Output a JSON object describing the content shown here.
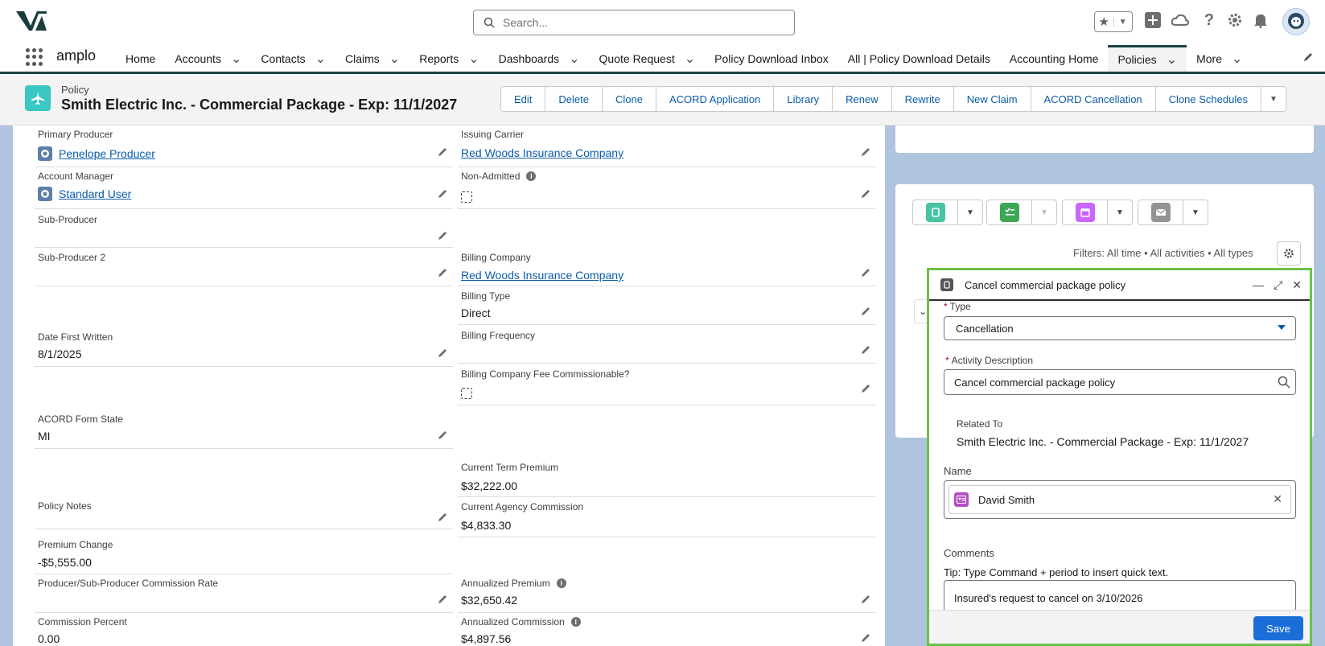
{
  "app": {
    "name": "amplo",
    "search_placeholder": "Search..."
  },
  "nav": {
    "items": [
      {
        "label": "Home",
        "dropdown": false
      },
      {
        "label": "Accounts",
        "dropdown": true
      },
      {
        "label": "Contacts",
        "dropdown": true
      },
      {
        "label": "Claims",
        "dropdown": true
      },
      {
        "label": "Reports",
        "dropdown": true
      },
      {
        "label": "Dashboards",
        "dropdown": true
      },
      {
        "label": "Quote Request",
        "dropdown": true
      },
      {
        "label": "Policy Download Inbox",
        "dropdown": false
      },
      {
        "label": "All | Policy Download Details",
        "dropdown": false
      },
      {
        "label": "Accounting Home",
        "dropdown": false
      },
      {
        "label": "Policies",
        "dropdown": true,
        "active": true
      },
      {
        "label": "More",
        "dropdown": true
      }
    ]
  },
  "record": {
    "object_type": "Policy",
    "title": "Smith Electric Inc. - Commercial Package - Exp: 11/1/2027",
    "actions": [
      "Edit",
      "Delete",
      "Clone",
      "ACORD Application",
      "Library",
      "Renew",
      "Rewrite",
      "New Claim",
      "ACORD Cancellation",
      "Clone Schedules"
    ]
  },
  "fields_left": {
    "primary_producer": {
      "label": "Primary Producer",
      "value": "Penelope Producer"
    },
    "account_manager": {
      "label": "Account Manager",
      "value": "Standard User"
    },
    "sub_producer": {
      "label": "Sub-Producer",
      "value": ""
    },
    "sub_producer_2": {
      "label": "Sub-Producer 2",
      "value": ""
    },
    "date_first_written": {
      "label": "Date First Written",
      "value": "8/1/2025"
    },
    "acord_form_state": {
      "label": "ACORD Form State",
      "value": "MI"
    },
    "policy_notes": {
      "label": "Policy Notes",
      "value": ""
    },
    "premium_change": {
      "label": "Premium Change",
      "value": "-$5,555.00"
    },
    "commission_rate": {
      "label": "Producer/Sub-Producer Commission Rate",
      "value": ""
    },
    "commission_percent": {
      "label": "Commission Percent",
      "value": "0.00"
    }
  },
  "fields_right": {
    "issuing_carrier": {
      "label": "Issuing Carrier",
      "value": "Red Woods Insurance Company"
    },
    "non_admitted": {
      "label": "Non-Admitted"
    },
    "billing_company": {
      "label": "Billing Company",
      "value": "Red Woods Insurance Company"
    },
    "billing_type": {
      "label": "Billing Type",
      "value": "Direct"
    },
    "billing_frequency": {
      "label": "Billing Frequency",
      "value": ""
    },
    "billing_fee_commissionable": {
      "label": "Billing Company Fee Commissionable?"
    },
    "current_term_premium": {
      "label": "Current Term Premium",
      "value": "$32,222.00"
    },
    "current_agency_commission": {
      "label": "Current Agency Commission",
      "value": "$4,833.30"
    },
    "annualized_premium": {
      "label": "Annualized Premium",
      "value": "$32,650.42"
    },
    "annualized_commission": {
      "label": "Annualized Commission",
      "value": "$4,897.56"
    }
  },
  "activity": {
    "filters": "Filters: All time • All activities • All types"
  },
  "modal": {
    "title": "Cancel commercial package policy",
    "type_label": "Type",
    "type_value": "Cancellation",
    "desc_label": "Activity Description",
    "desc_value": "Cancel commercial package policy",
    "related_label": "Related To",
    "related_value": "Smith Electric Inc. - Commercial Package - Exp: 11/1/2027",
    "name_label": "Name",
    "name_value": "David Smith",
    "comments_label": "Comments",
    "comments_tip": "Tip: Type Command + period to insert quick text.",
    "comments_value": "Insured's request to cancel on 3/10/2026",
    "save_label": "Save"
  },
  "colors": {
    "brand": "#1b4443",
    "link": "#0b5cab",
    "modal_border": "#6cc24a",
    "save": "#1b6ed8"
  }
}
